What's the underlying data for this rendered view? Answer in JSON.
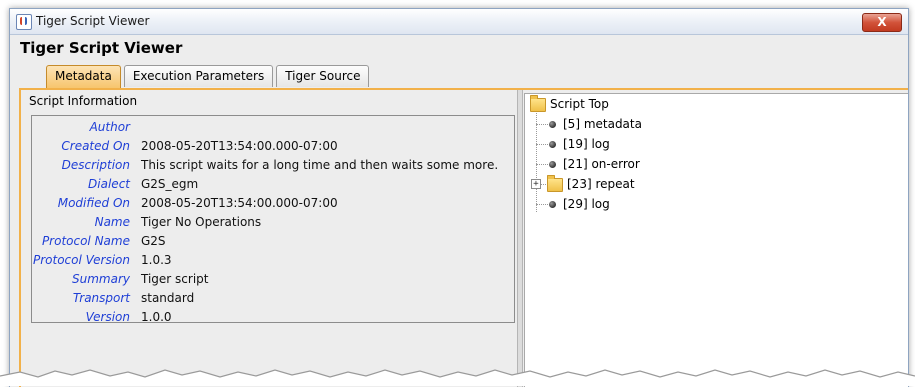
{
  "window": {
    "title": "Tiger Script Viewer",
    "close_label": "X"
  },
  "header": {
    "title": "Tiger Script Viewer"
  },
  "tabs": [
    {
      "label": "Metadata",
      "active": true
    },
    {
      "label": "Execution Parameters",
      "active": false
    },
    {
      "label": "Tiger Source",
      "active": false
    }
  ],
  "script_info": {
    "section_title": "Script Information",
    "rows": [
      {
        "label": "Author",
        "value": ""
      },
      {
        "label": "Created On",
        "value": "2008-05-20T13:54:00.000-07:00"
      },
      {
        "label": "Description",
        "value": "This script waits for a long time and then waits some more."
      },
      {
        "label": "Dialect",
        "value": "G2S_egm"
      },
      {
        "label": "Modified On",
        "value": "2008-05-20T13:54:00.000-07:00"
      },
      {
        "label": "Name",
        "value": "Tiger No Operations"
      },
      {
        "label": "Protocol Name",
        "value": "G2S"
      },
      {
        "label": "Protocol Version",
        "value": "1.0.3"
      },
      {
        "label": "Summary",
        "value": "Tiger script"
      },
      {
        "label": "Transport",
        "value": "standard"
      },
      {
        "label": "Version",
        "value": "1.0.0"
      }
    ]
  },
  "tree": {
    "root": "Script Top",
    "nodes": [
      {
        "label": "[5] metadata",
        "type": "leaf"
      },
      {
        "label": "[19] log",
        "type": "leaf"
      },
      {
        "label": "[21] on-error",
        "type": "leaf"
      },
      {
        "label": "[23] repeat",
        "type": "folder",
        "expand_symbol": "+"
      },
      {
        "label": "[29] log",
        "type": "leaf"
      }
    ]
  },
  "colors": {
    "accent_border": "#f2b14a",
    "label_blue": "#1f3fd6",
    "close_red": "#c23a20"
  }
}
